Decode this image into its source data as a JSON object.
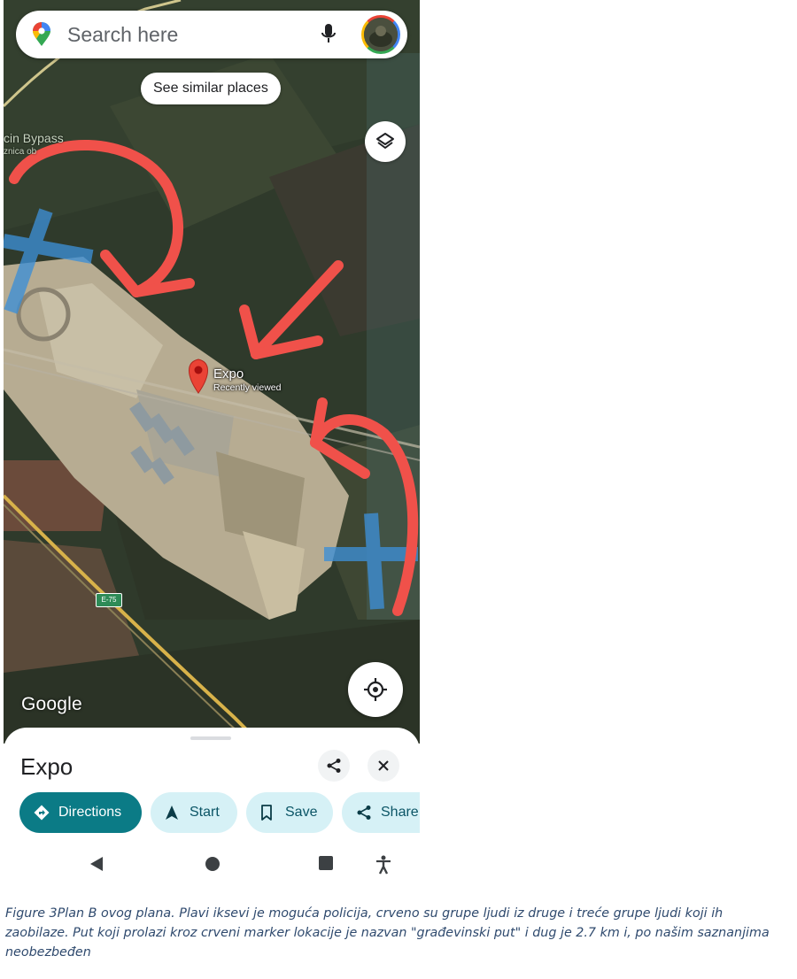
{
  "search": {
    "placeholder": "Search here"
  },
  "chip": {
    "label": "See similar places"
  },
  "map": {
    "road_label": "cin Bypass",
    "road_label_sub": "znica ob",
    "road_shield": "E-75",
    "attribution": "Google",
    "marker": {
      "name": "Expo",
      "subtitle": "Recently viewed",
      "color": "#ea4335"
    },
    "annotation_colors": {
      "arrows": "#f0514a",
      "crosses": "#3d8fd6"
    }
  },
  "sheet": {
    "title": "Expo",
    "actions": [
      {
        "label": "Directions",
        "icon": "directions-icon"
      },
      {
        "label": "Start",
        "icon": "navigation-arrow-icon"
      },
      {
        "label": "Save",
        "icon": "bookmark-icon"
      },
      {
        "label": "Share",
        "icon": "share-icon"
      }
    ]
  },
  "caption": "Figure 3Plan B ovog plana. Plavi iksevi je moguća policija, crveno su grupe ljudi iz druge i treće grupe ljudi koji ih zaobilaze. Put koji prolazi kroz crveni marker lokacije je nazvan \"građevinski put\" i dug je 2.7 km i, po našim saznanjima neobezbeđen"
}
